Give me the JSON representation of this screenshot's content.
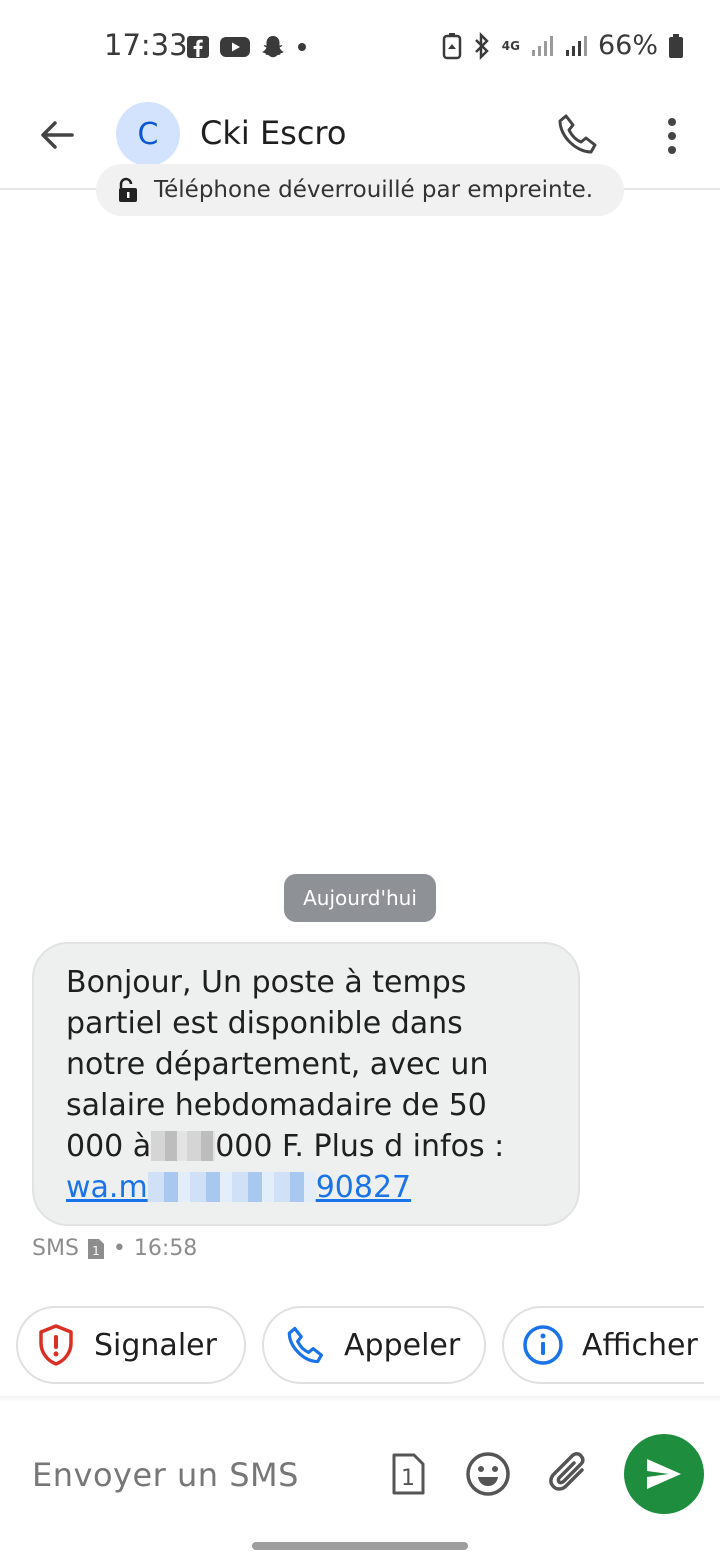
{
  "status_bar": {
    "time": "17:33",
    "app_icons": [
      "facebook-icon",
      "youtube-icon",
      "snapchat-icon",
      "dot-icon"
    ],
    "network": "4G",
    "battery_percent": "66%"
  },
  "header": {
    "avatar_letter": "C",
    "contact_name": "Cki Escro",
    "icons": [
      "back-arrow-icon",
      "phone-icon",
      "more-vert-icon"
    ]
  },
  "toast": {
    "text": "Téléphone déverrouillé par empreinte."
  },
  "conversation": {
    "date_chip": "Aujourd'hui",
    "message": {
      "line1": "Bonjour, Un poste à temps",
      "line2": "partiel est disponible dans",
      "line3": "notre département, avec un",
      "line4": "salaire hebdomadaire de 50",
      "line5_a": "000 à",
      "line5_b": "000 F. Plus d infos :",
      "link_a": "wa.m",
      "link_b": "90827"
    },
    "meta": {
      "channel": "SMS",
      "sim": "1",
      "separator": "•",
      "time": "16:58"
    }
  },
  "suggestions": [
    {
      "label": "Signaler",
      "icon": "shield-alert-icon"
    },
    {
      "label": "Appeler",
      "icon": "phone-icon"
    },
    {
      "label": "Afficher l",
      "icon": "info-icon"
    }
  ],
  "composer": {
    "placeholder": "Envoyer un SMS",
    "sim_label": "1",
    "icons": [
      "sim-icon",
      "emoji-icon",
      "attach-icon",
      "send-icon"
    ]
  },
  "colors": {
    "accent_blue": "#1a73e8",
    "send_green": "#1e8e3e",
    "bubble_bg": "#eeefef",
    "alert_red": "#d93025",
    "avatar_bg": "#d3e3fd"
  }
}
